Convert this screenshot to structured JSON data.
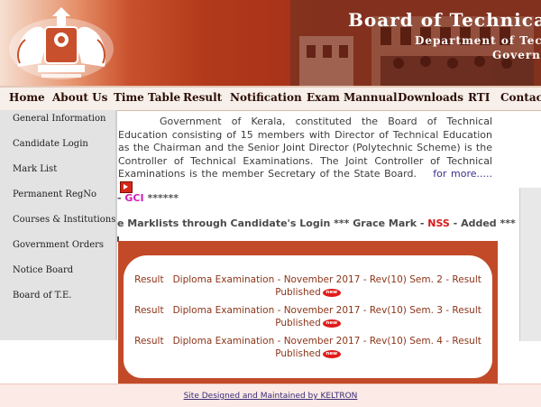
{
  "header": {
    "title": "Board of Technical E",
    "department": "Department of Techn",
    "government": "Governm"
  },
  "nav": {
    "items": [
      "Home",
      "About Us",
      "Time Table",
      "Result",
      "Notification",
      "Exam Mannual",
      "Downloads",
      "RTI",
      "Contact"
    ]
  },
  "sidebar": {
    "items": [
      "General Information",
      "Candidate Login",
      "Mark List",
      "Permanent RegNo",
      "Courses & Institutions",
      "Government Orders",
      "Notice Board",
      "Board of T.E."
    ]
  },
  "intro": {
    "text": "Government of Kerala, constituted the Board of Technical Education consisting of 15 members with Director of Technical Education as the Chairman and the Senior Joint Director (Polytechnic Scheme) is the Controller of Technical Examinations. The Joint Controller of Technical Examinations is the member Secretary of the State Board.",
    "more_link": "for more....."
  },
  "marquee1": {
    "prefix": "- ",
    "gci": "GCI",
    "suffix": " ******"
  },
  "marquee2": {
    "prefix": "e Marklists through Candidate's Login *** Grace Mark - ",
    "nss": "NSS",
    "suffix": " - Added ***"
  },
  "results": [
    {
      "label": "Result",
      "text": "Diploma Examination - November 2017 - Rev(10) Sem. 2 - Result Published"
    },
    {
      "label": "Result",
      "text": "Diploma Examination - November 2017 - Rev(10) Sem. 3 - Result Published"
    },
    {
      "label": "Result",
      "text": "Diploma Examination - November 2017 - Rev(10) Sem. 4 - Result Published"
    }
  ],
  "new_badge": "new",
  "footer": {
    "text": "Site Designed and Maintained by   KELTRON"
  },
  "colors": {
    "header_red": "#b23a1b",
    "nav_text": "#2a0d05",
    "result_text": "#8c3418",
    "gci": "#d01fb4",
    "nss": "#d61a1a"
  }
}
